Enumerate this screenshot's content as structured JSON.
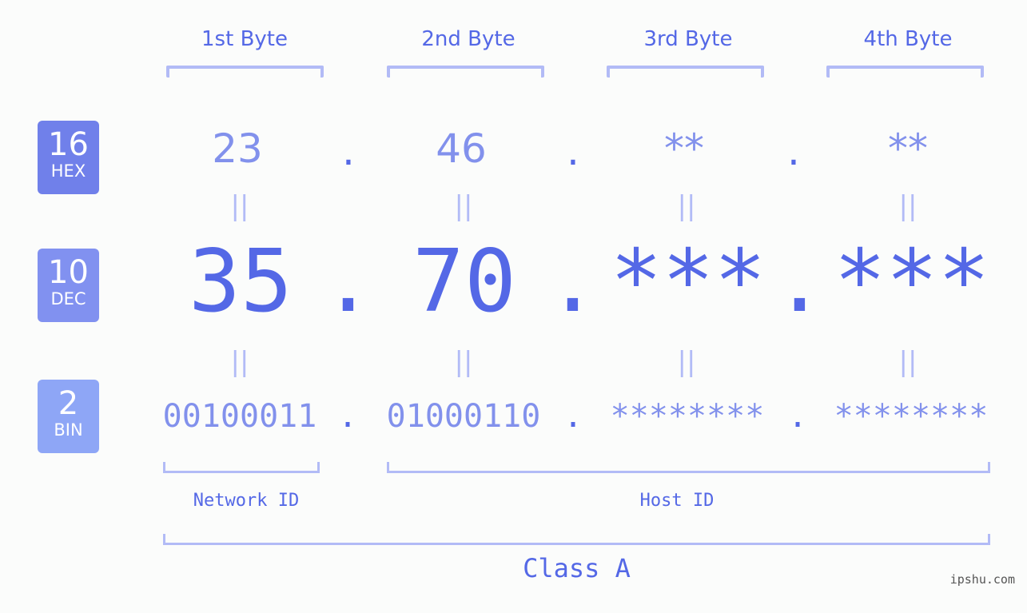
{
  "byte_headers": [
    "1st Byte",
    "2nd Byte",
    "3rd Byte",
    "4th Byte"
  ],
  "badges": [
    {
      "number": "16",
      "label": "HEX",
      "color": "#7080ea"
    },
    {
      "number": "10",
      "label": "DEC",
      "color": "#8191f0"
    },
    {
      "number": "2",
      "label": "BIN",
      "color": "#8ea6f6"
    }
  ],
  "hex_octets": [
    "23",
    "46",
    "**",
    "**"
  ],
  "dec_octets": [
    "35",
    "70",
    "***",
    "***"
  ],
  "bin_octets": [
    "00100011",
    "01000110",
    "********",
    "********"
  ],
  "separator": ".",
  "equals": "||",
  "network_id_label": "Network ID",
  "host_id_label": "Host ID",
  "class_label": "Class A",
  "watermark": "ipshu.com",
  "colors": {
    "primary": "#5468e6",
    "secondary": "#8291ec",
    "bracket": "#b2bbf6"
  }
}
